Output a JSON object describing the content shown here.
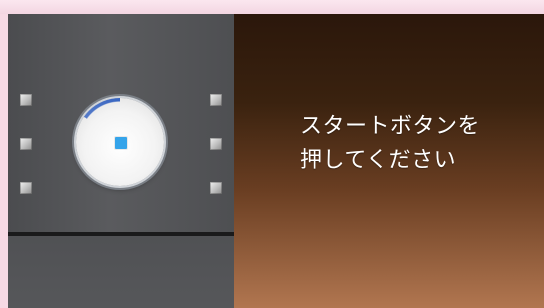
{
  "content": {
    "message_line1": "スタートボタンを",
    "message_line2": "押してください"
  },
  "icons": {
    "led": "square-indicator-icon",
    "knob": "round-start-button"
  },
  "colors": {
    "accent_blue": "#35a4ea",
    "arc_blue": "#2f5fbf",
    "panel_gray": "#56575a",
    "bg_pink": "#f6d9e4",
    "brown_dark": "#2b170b",
    "brown_light": "#b17650"
  }
}
